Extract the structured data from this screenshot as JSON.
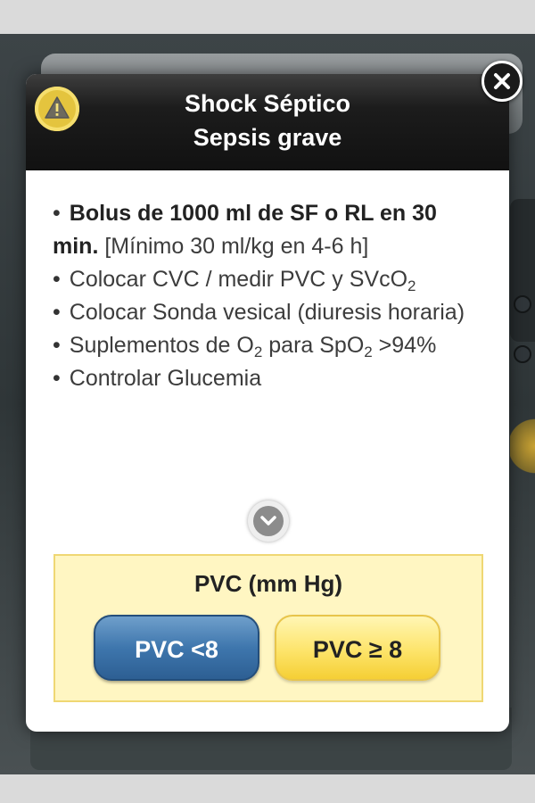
{
  "header": {
    "title_line1": "Shock Séptico",
    "title_line2": "Sepsis grave",
    "warning_icon": "warning-triangle-icon",
    "close_icon": "close-icon"
  },
  "content": {
    "items": [
      {
        "bullet": "•",
        "bold": "Bolus de 1000 ml de SF o RL en 30 min.",
        "rest": " [Mínimo 30 ml/kg en 4-6 h]"
      },
      {
        "bullet": "•",
        "text_a": "Colocar CVC / medir PVC y SVcO",
        "sub_a": "2"
      },
      {
        "bullet": "•",
        "text": "Colocar Sonda vesical (diuresis horaria)"
      },
      {
        "bullet": "•",
        "text_a": "Suplementos de O",
        "sub_a": "2",
        "text_b": " para SpO",
        "sub_b": "2",
        "text_c": " >94%"
      },
      {
        "bullet": "•",
        "text": "Controlar Glucemia"
      }
    ],
    "expand_icon": "chevron-down-icon"
  },
  "pvc": {
    "title": "PVC (mm Hg)",
    "low_label": "PVC <8",
    "high_label": "PVC ≥ 8"
  },
  "colors": {
    "header_bg": "#111111",
    "warning_badge": "#e4c43e",
    "panel_bg": "#fff6c2",
    "low_button": "#3e76ad",
    "high_button": "#fde46a"
  }
}
